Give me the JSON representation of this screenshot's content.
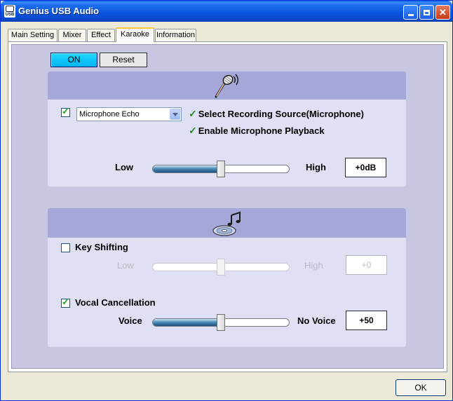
{
  "window": {
    "title": "Genius USB Audio",
    "icon_text": "USB",
    "controls": {
      "minimize": "minimize",
      "maximize": "maximize",
      "close": "✕"
    }
  },
  "tabs": [
    {
      "label": "Main Setting"
    },
    {
      "label": "Mixer"
    },
    {
      "label": "Effect"
    },
    {
      "label": "Karaoke",
      "active": true
    },
    {
      "label": "Information"
    }
  ],
  "toolbar": {
    "on_label": "ON",
    "reset_label": "Reset",
    "on_color": "#00b8f0"
  },
  "mic_panel": {
    "icon": "microphone-icon",
    "enabled_checked": true,
    "effect_select": {
      "value": "Microphone Echo"
    },
    "notes": [
      "Select Recording Source(Microphone)",
      "Enable Microphone Playback"
    ],
    "slider": {
      "low_label": "Low",
      "high_label": "High",
      "value_label": "+0dB",
      "position_fraction": 0.5
    }
  },
  "music_panel": {
    "icon": "music-cd-icon",
    "key_shifting": {
      "label": "Key Shifting",
      "checked": false,
      "low_label": "Low",
      "high_label": "High",
      "value_label": "+0",
      "position_fraction": 0.5
    },
    "vocal_cancellation": {
      "label": "Vocal Cancellation",
      "checked": true,
      "low_label": "Voice",
      "high_label": "No Voice",
      "value_label": "+50",
      "position_fraction": 0.5
    }
  },
  "footer": {
    "ok_label": "OK"
  }
}
